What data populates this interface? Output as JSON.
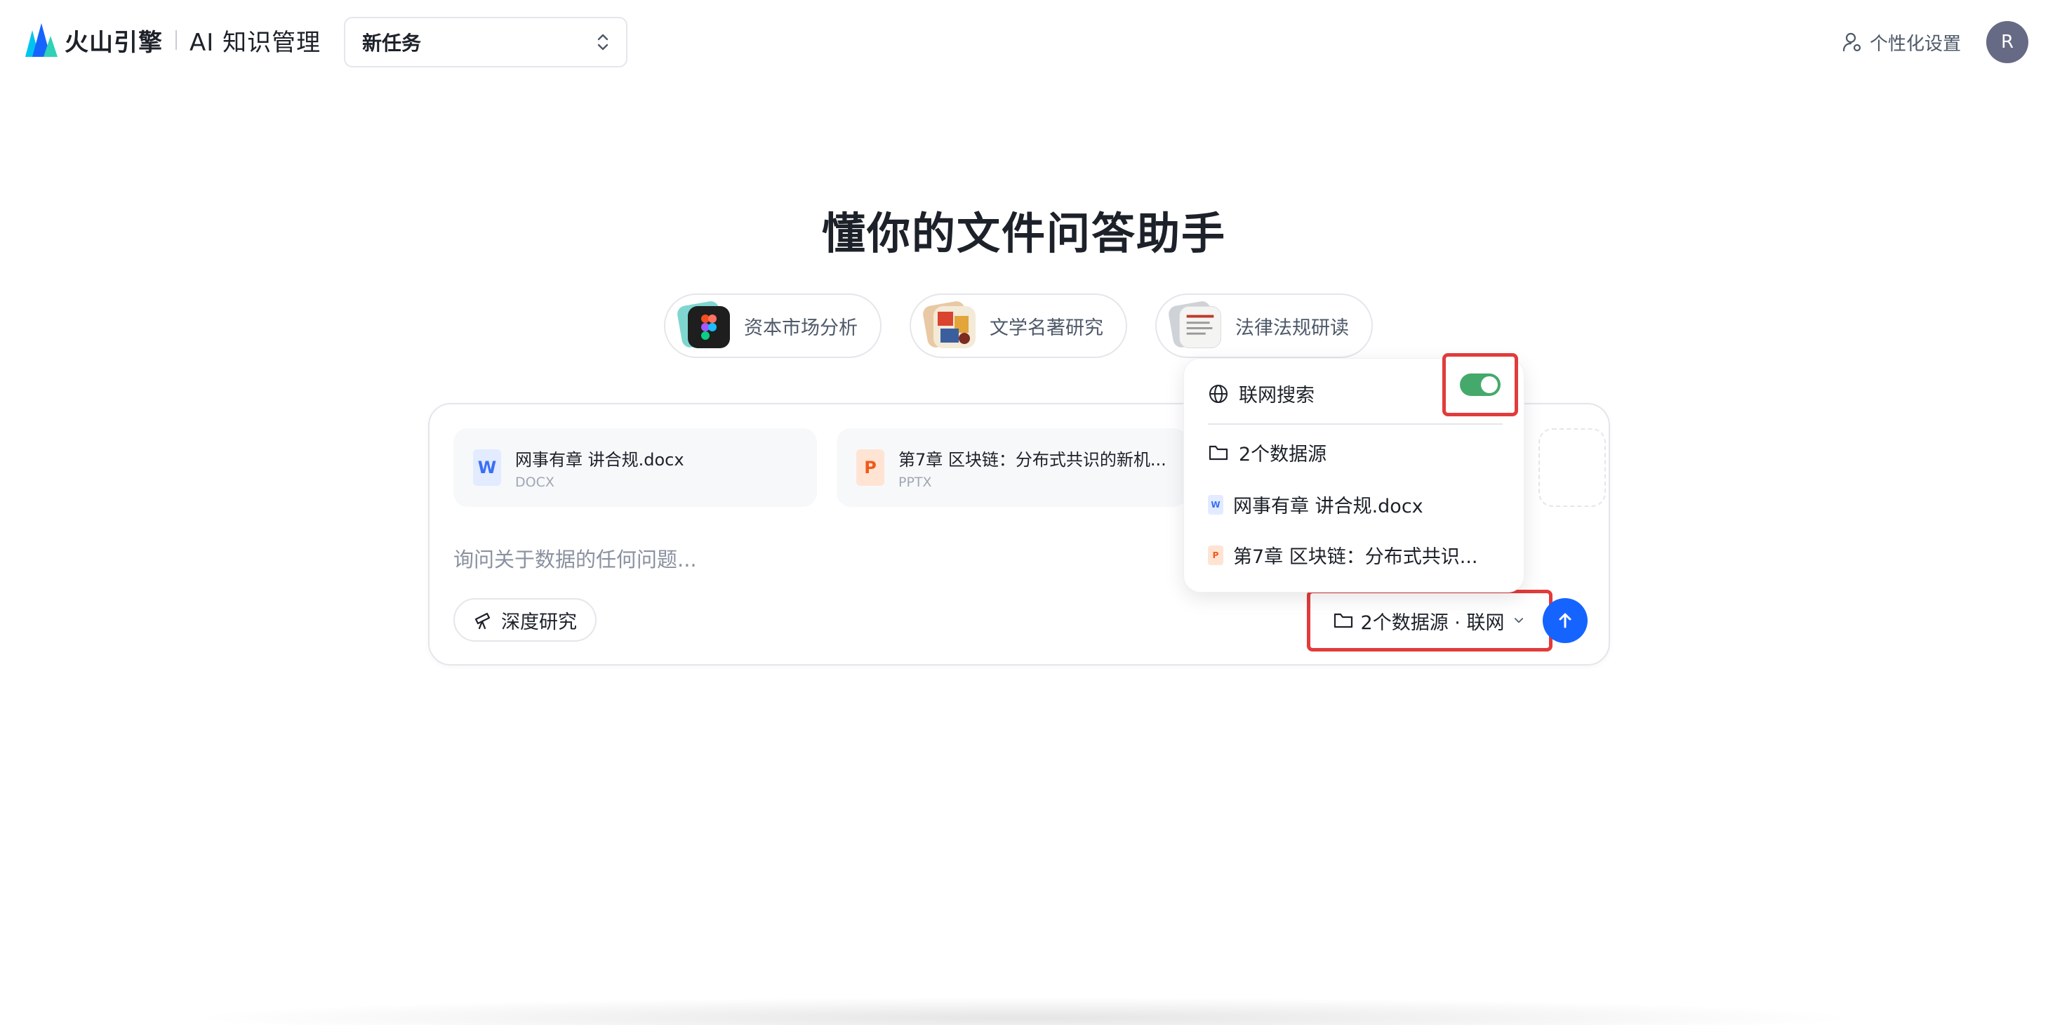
{
  "header": {
    "brand": "火山引擎",
    "product": "AI 知识管理",
    "task_select": "新任务",
    "personalize": "个性化设置",
    "avatar_initial": "R"
  },
  "hero": {
    "title": "懂你的文件问答助手"
  },
  "chips": [
    {
      "label": "资本市场分析"
    },
    {
      "label": "文学名著研究"
    },
    {
      "label": "法律法规研读"
    }
  ],
  "ask": {
    "files": [
      {
        "name": "网事有章 讲合规.docx",
        "type": "DOCX",
        "icon_letter": "W"
      },
      {
        "name": "第7章 区块链：分布式共识的新机...",
        "type": "PPTX",
        "icon_letter": "P"
      }
    ],
    "placeholder": "询问关于数据的任何问题...",
    "deep_research": "深度研究",
    "sources_label": "2个数据源 · 联网"
  },
  "popover": {
    "web_search": "联网搜索",
    "web_search_on": true,
    "sources_header": "2个数据源",
    "items": [
      {
        "name": "网事有章 讲合规.docx",
        "icon_letter": "W"
      },
      {
        "name": "第7章 区块链：分布式共识...",
        "icon_letter": "P"
      }
    ]
  },
  "colors": {
    "accent": "#1664ff",
    "toggle_on": "#44a96a",
    "highlight": "#e23b3b",
    "avatar_bg": "#676a85"
  }
}
